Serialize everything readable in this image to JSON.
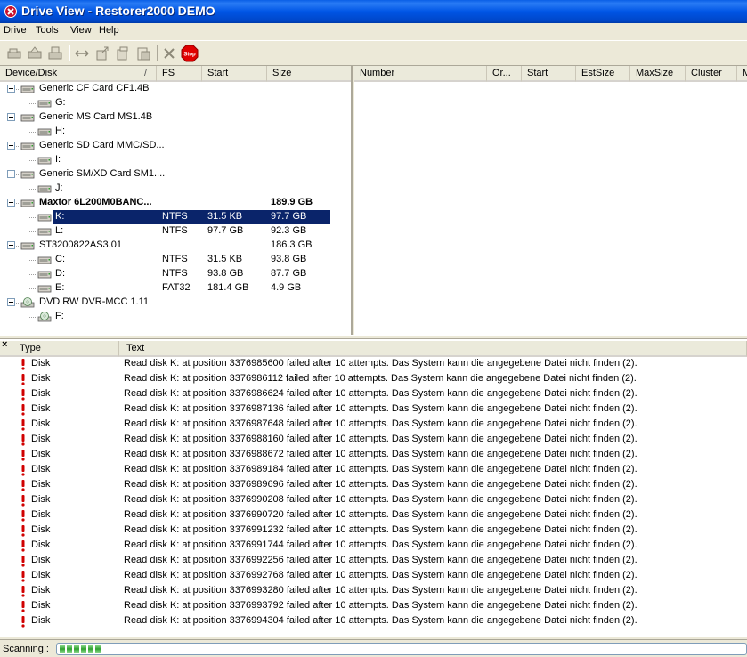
{
  "window": {
    "title": "Drive View - Restorer2000 DEMO"
  },
  "menu": [
    "Drive",
    "Tools",
    "View",
    "Help"
  ],
  "toolbar": {
    "buttons": [
      "open-drive-icon",
      "open-image-icon",
      "scan-icon",
      "interval-icon",
      "save-icon",
      "save-all-icon",
      "export-icon",
      "delete-icon",
      "stop-icon"
    ],
    "stop_label": "Stop"
  },
  "drive_tree": {
    "headers": [
      "Device/Disk",
      "/",
      "FS",
      "Start",
      "Size"
    ],
    "rows": [
      {
        "type": "device",
        "name": "Generic CF Card CF1.4B",
        "fs": "",
        "start": "",
        "size": "",
        "bold": false
      },
      {
        "type": "partition",
        "name": "G:",
        "fs": "",
        "start": "",
        "size": ""
      },
      {
        "type": "device",
        "name": "Generic MS Card MS1.4B",
        "fs": "",
        "start": "",
        "size": "",
        "bold": false
      },
      {
        "type": "partition",
        "name": "H:",
        "fs": "",
        "start": "",
        "size": ""
      },
      {
        "type": "device",
        "name": "Generic SD Card MMC/SD...",
        "fs": "",
        "start": "",
        "size": "",
        "bold": false
      },
      {
        "type": "partition",
        "name": "I:",
        "fs": "",
        "start": "",
        "size": ""
      },
      {
        "type": "device",
        "name": "Generic SM/XD Card SM1....",
        "fs": "",
        "start": "",
        "size": "",
        "bold": false
      },
      {
        "type": "partition",
        "name": "J:",
        "fs": "",
        "start": "",
        "size": ""
      },
      {
        "type": "device",
        "name": "Maxtor 6L200M0BANC...",
        "fs": "",
        "start": "",
        "size": "189.9 GB",
        "bold": true
      },
      {
        "type": "partition",
        "name": "K:",
        "fs": "NTFS",
        "start": "31.5 KB",
        "size": "97.7 GB",
        "selected": true
      },
      {
        "type": "partition",
        "name": "L:",
        "fs": "NTFS",
        "start": "97.7 GB",
        "size": "92.3 GB"
      },
      {
        "type": "device",
        "name": "ST3200822AS3.01",
        "fs": "",
        "start": "",
        "size": "186.3 GB",
        "bold": false
      },
      {
        "type": "partition",
        "name": "C:",
        "fs": "NTFS",
        "start": "31.5 KB",
        "size": "93.8 GB"
      },
      {
        "type": "partition",
        "name": "D:",
        "fs": "NTFS",
        "start": "93.8 GB",
        "size": "87.7 GB"
      },
      {
        "type": "partition",
        "name": "E:",
        "fs": "FAT32",
        "start": "181.4 GB",
        "size": "4.9 GB"
      },
      {
        "type": "device-cd",
        "name": "DVD RW DVR-MCC 1.11",
        "fs": "",
        "start": "",
        "size": "",
        "bold": false
      },
      {
        "type": "partition-cd",
        "name": "F:",
        "fs": "",
        "start": "",
        "size": ""
      }
    ]
  },
  "files_panel": {
    "headers": [
      "Number",
      "Or...",
      "Start",
      "EstSize",
      "MaxSize",
      "Cluster",
      "M"
    ]
  },
  "log": {
    "headers": [
      "Type",
      "Text"
    ],
    "rows": [
      {
        "type": "Disk",
        "text": "Read disk K: at position 3376985600 failed after 10 attempts. Das System kann die angegebene Datei nicht finden (2)."
      },
      {
        "type": "Disk",
        "text": "Read disk K: at position 3376986112 failed after 10 attempts. Das System kann die angegebene Datei nicht finden (2)."
      },
      {
        "type": "Disk",
        "text": "Read disk K: at position 3376986624 failed after 10 attempts. Das System kann die angegebene Datei nicht finden (2)."
      },
      {
        "type": "Disk",
        "text": "Read disk K: at position 3376987136 failed after 10 attempts. Das System kann die angegebene Datei nicht finden (2)."
      },
      {
        "type": "Disk",
        "text": "Read disk K: at position 3376987648 failed after 10 attempts. Das System kann die angegebene Datei nicht finden (2)."
      },
      {
        "type": "Disk",
        "text": "Read disk K: at position 3376988160 failed after 10 attempts. Das System kann die angegebene Datei nicht finden (2)."
      },
      {
        "type": "Disk",
        "text": "Read disk K: at position 3376988672 failed after 10 attempts. Das System kann die angegebene Datei nicht finden (2)."
      },
      {
        "type": "Disk",
        "text": "Read disk K: at position 3376989184 failed after 10 attempts. Das System kann die angegebene Datei nicht finden (2)."
      },
      {
        "type": "Disk",
        "text": "Read disk K: at position 3376989696 failed after 10 attempts. Das System kann die angegebene Datei nicht finden (2)."
      },
      {
        "type": "Disk",
        "text": "Read disk K: at position 3376990208 failed after 10 attempts. Das System kann die angegebene Datei nicht finden (2)."
      },
      {
        "type": "Disk",
        "text": "Read disk K: at position 3376990720 failed after 10 attempts. Das System kann die angegebene Datei nicht finden (2)."
      },
      {
        "type": "Disk",
        "text": "Read disk K: at position 3376991232 failed after 10 attempts. Das System kann die angegebene Datei nicht finden (2)."
      },
      {
        "type": "Disk",
        "text": "Read disk K: at position 3376991744 failed after 10 attempts. Das System kann die angegebene Datei nicht finden (2)."
      },
      {
        "type": "Disk",
        "text": "Read disk K: at position 3376992256 failed after 10 attempts. Das System kann die angegebene Datei nicht finden (2)."
      },
      {
        "type": "Disk",
        "text": "Read disk K: at position 3376992768 failed after 10 attempts. Das System kann die angegebene Datei nicht finden (2)."
      },
      {
        "type": "Disk",
        "text": "Read disk K: at position 3376993280 failed after 10 attempts. Das System kann die angegebene Datei nicht finden (2)."
      },
      {
        "type": "Disk",
        "text": "Read disk K: at position 3376993792 failed after 10 attempts. Das System kann die angegebene Datei nicht finden (2)."
      },
      {
        "type": "Disk",
        "text": "Read disk K: at position 3376994304 failed after 10 attempts. Das System kann die angegebene Datei nicht finden (2)."
      }
    ]
  },
  "status": {
    "label": "Scanning :",
    "progress_fraction": 0.06
  },
  "colors": {
    "selection": "#0a246a",
    "error": "#d00000",
    "progress": "#2ea02e"
  }
}
